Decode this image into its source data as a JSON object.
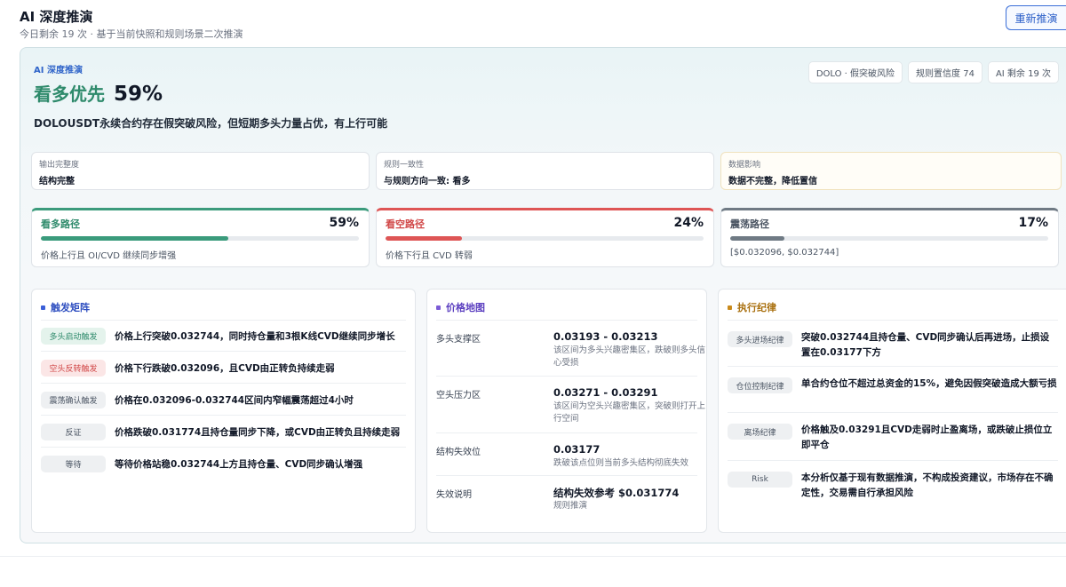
{
  "header": {
    "title": "AI 深度推演",
    "subtitle": "今日剩余 19 次 · 基于当前快照和规则场景二次推演",
    "refresh_label": "重新推演"
  },
  "summary": {
    "eyebrow": "AI 深度推演",
    "verdict": "看多优先",
    "probability": "59%",
    "text": "DOLOUSDT永续合约存在假突破风险，但短期多头力量占优，有上行可能",
    "chips": [
      "DOLO · 假突破风险",
      "规则置信度 74",
      "AI 剩余 19 次"
    ]
  },
  "metrics": [
    {
      "label": "输出完整度",
      "value": "结构完整"
    },
    {
      "label": "规则一致性",
      "value": "与规则方向一致: 看多"
    },
    {
      "label": "数据影响",
      "value": "数据不完整，降低置信"
    }
  ],
  "paths": [
    {
      "name": "看多路径",
      "pct_label": "59%",
      "fill": 0.59,
      "desc": "价格上行且 OI/CVD 继续同步增强",
      "color": "#3b9b7c"
    },
    {
      "name": "看空路径",
      "pct_label": "24%",
      "fill": 0.24,
      "desc": "价格下行且 CVD 转弱",
      "color": "#de5555"
    },
    {
      "name": "震荡路径",
      "pct_label": "17%",
      "fill": 0.17,
      "desc": "[$0.032096, $0.032744]",
      "color": "#6f7a84"
    }
  ],
  "triggers": {
    "title": "触发矩阵",
    "accent": "#3b5fd8",
    "rows": [
      {
        "badge": "多头启动触发",
        "text": "价格上行突破0.032744，同时持仓量和3根K线CVD继续同步增长"
      },
      {
        "badge": "空头反转触发",
        "text": "价格下行跌破0.032096，且CVD由正转负持续走弱"
      },
      {
        "badge": "震荡确认触发",
        "text": "价格在0.032096-0.032744区间内窄幅震荡超过4小时"
      },
      {
        "badge": "反证",
        "text": "价格跌破0.031774且持仓量同步下降，或CVD由正转负且持续走弱"
      },
      {
        "badge": "等待",
        "text": "等待价格站稳0.032744上方且持仓量、CVD同步确认增强"
      }
    ]
  },
  "price_map": {
    "title": "价格地图",
    "accent": "#7c5cd6",
    "rows": [
      {
        "label": "多头支撑区",
        "value": "0.03193 - 0.03213",
        "note": "该区间为多头兴趣密集区，跌破则多头信心受损"
      },
      {
        "label": "空头压力区",
        "value": "0.03271 - 0.03291",
        "note": "该区间为空头兴趣密集区，突破则打开上行空间"
      },
      {
        "label": "结构失效位",
        "value": "0.03177",
        "note": "跌破该点位则当前多头结构彻底失效"
      },
      {
        "label": "失效说明",
        "value": "结构失效参考 $0.031774",
        "note": "规则推演"
      }
    ]
  },
  "discipline": {
    "title": "执行纪律",
    "accent": "#c98a1c",
    "rows": [
      {
        "badge": "多头进场纪律",
        "text": "突破0.032744且持仓量、CVD同步确认后再进场，止损设置在0.03177下方"
      },
      {
        "badge": "仓位控制纪律",
        "text": "单合约仓位不超过总资金的15%，避免因假突破造成大额亏损"
      },
      {
        "badge": "离场纪律",
        "text": "价格触及0.03291且CVD走弱时止盈离场，或跌破止损位立即平仓"
      },
      {
        "badge": "Risk",
        "text": "本分析仅基于现有数据推演，不构成投资建议，市场存在不确定性，交易需自行承担风险"
      }
    ]
  }
}
